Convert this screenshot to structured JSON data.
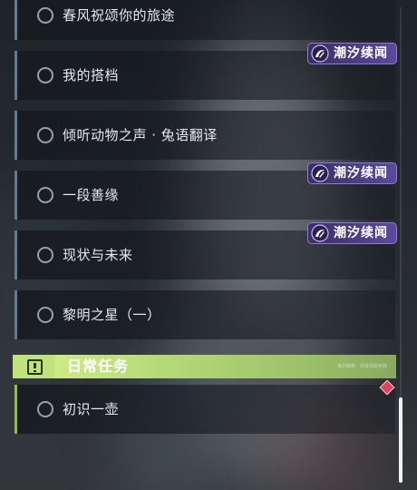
{
  "quests": [
    {
      "label": "春风祝颂你的旅途"
    },
    {
      "label": "我的搭档"
    },
    {
      "label": "倾听动物之声 · 兔语翻译"
    },
    {
      "label": "一段善缘"
    },
    {
      "label": "现状与未来"
    },
    {
      "label": "黎明之星（一）"
    }
  ],
  "badge": {
    "label": "潮汐续闻",
    "icon": "tide-swirl-icon"
  },
  "daily_section": {
    "title": "日常任务",
    "subtitle": "每日刷新 · 完成领取奖励",
    "icon": "alert-square-icon",
    "quests": [
      {
        "label": "初识一壶"
      }
    ]
  },
  "colors": {
    "quest_accent": "#5f7c90",
    "daily_accent": "#8fbf4e",
    "badge_bg": "#4b3d87",
    "marker": "#e0445a"
  }
}
